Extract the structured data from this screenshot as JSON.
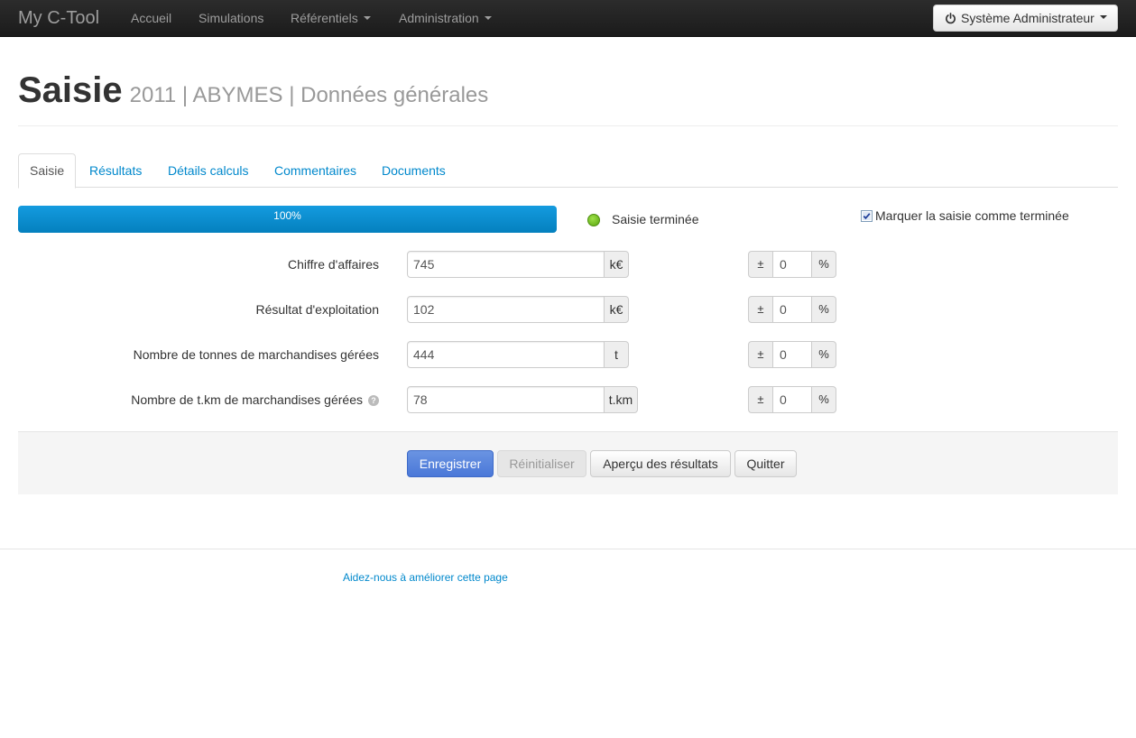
{
  "navbar": {
    "brand": "My C-Tool",
    "items": [
      {
        "label": "Accueil"
      },
      {
        "label": "Simulations"
      },
      {
        "label": "Référentiels"
      },
      {
        "label": "Administration"
      }
    ],
    "user": "Système Administrateur"
  },
  "header": {
    "title": "Saisie",
    "subtitle": "2011 | ABYMES | Données générales"
  },
  "tabs": [
    {
      "label": "Saisie",
      "active": true
    },
    {
      "label": "Résultats"
    },
    {
      "label": "Détails calculs"
    },
    {
      "label": "Commentaires"
    },
    {
      "label": "Documents"
    }
  ],
  "progress": {
    "value": 100,
    "label": "100%",
    "status": "Saisie terminée",
    "status_color": "#7cc631",
    "mark_done_label": "Marquer la saisie comme terminée",
    "mark_done_checked": true
  },
  "form": {
    "rows": [
      {
        "label": "Chiffre d'affaires",
        "value": "745",
        "unit": "k€",
        "pm": "±",
        "uncertainty": "0",
        "pct": "%"
      },
      {
        "label": "Résultat d'exploitation",
        "value": "102",
        "unit": "k€",
        "pm": "±",
        "uncertainty": "0",
        "pct": "%"
      },
      {
        "label": "Nombre de tonnes de marchandises gérées",
        "value": "444",
        "unit": "t",
        "pm": "±",
        "uncertainty": "0",
        "pct": "%"
      },
      {
        "label": "Nombre de t.km de marchandises gérées",
        "value": "78",
        "unit": "t.km",
        "pm": "±",
        "uncertainty": "0",
        "pct": "%",
        "help_icon": "question-icon"
      }
    ]
  },
  "actions": {
    "save": "Enregistrer",
    "reset": "Réinitialiser",
    "preview": "Aperçu des résultats",
    "quit": "Quitter"
  },
  "footer": {
    "link": "Aidez-nous à améliorer cette page"
  },
  "colors": {
    "primary": "#4a78d8",
    "link": "#0088cc",
    "progress": "#0e8fd4"
  }
}
